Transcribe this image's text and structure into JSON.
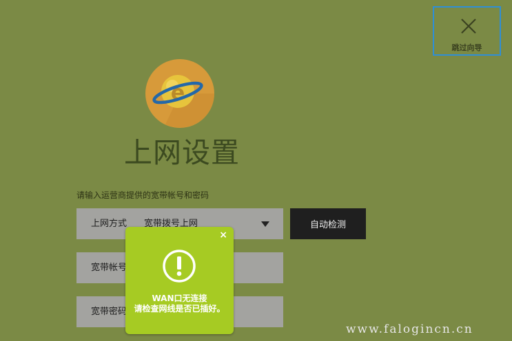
{
  "skip": {
    "label": "跳过向导"
  },
  "page": {
    "title": "上网设置",
    "hint": "请输入运营商提供的宽带帐号和密码"
  },
  "form": {
    "connection_type": {
      "label": "上网方式",
      "value": "宽带拨号上网"
    },
    "account": {
      "label": "宽带帐号"
    },
    "password": {
      "label": "宽带密码"
    },
    "detect_label": "自动检测"
  },
  "popup": {
    "close": "×",
    "line1": "WAN口无连接",
    "line2": "请检查网线是否已插好。"
  },
  "watermark": "www.falogincn.cn",
  "colors": {
    "background": "#7b8a45",
    "popup": "#a6cb23",
    "skip_border": "#2f8fd6",
    "logo": "#d79a3a"
  }
}
